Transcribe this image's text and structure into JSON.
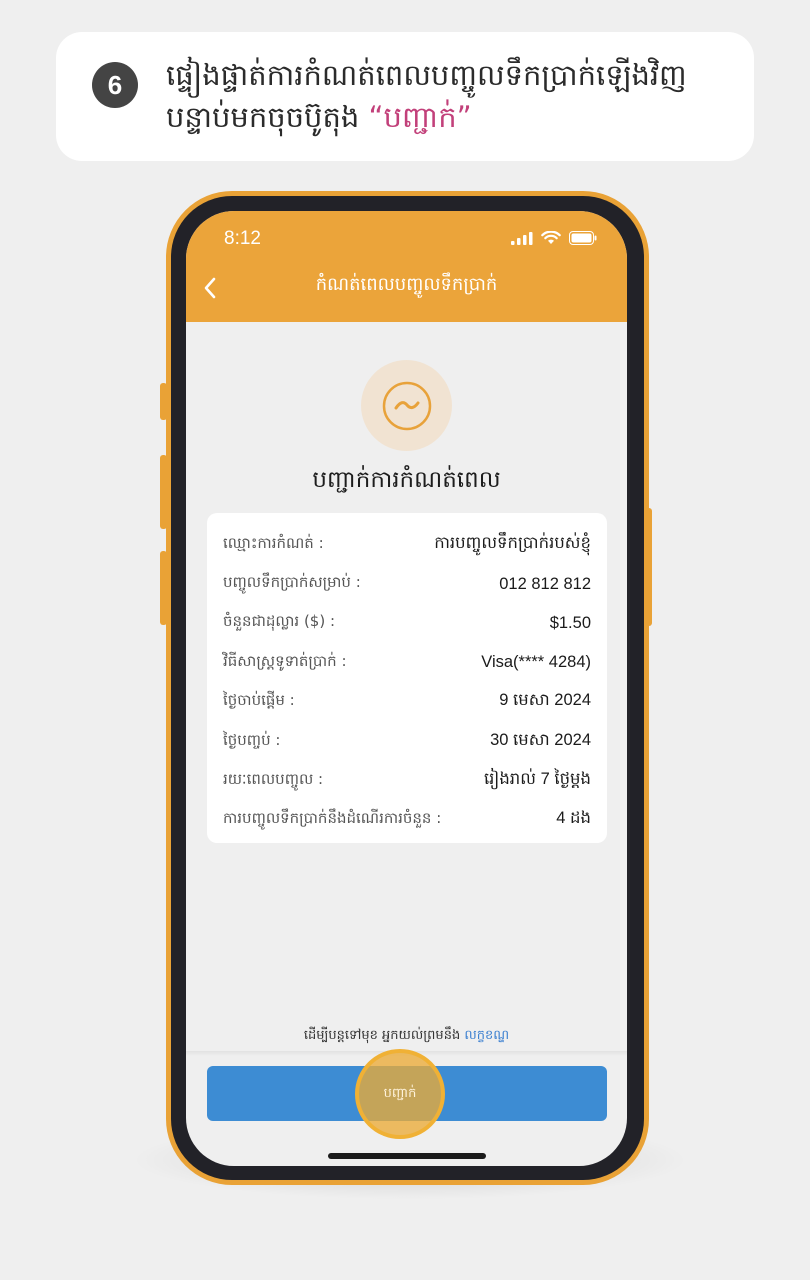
{
  "instruction": {
    "step_number": "6",
    "line1": "ផ្ទៀងផ្ទាត់ការកំណត់ពេលបញ្ចូលទឹកប្រាក់ឡើងវិញ",
    "line2_prefix": "បន្ទាប់មកចុចប៊ូតុង ",
    "line2_highlight": "“បញ្ជាក់”"
  },
  "status_bar": {
    "time": "8:12"
  },
  "header": {
    "title": "កំណត់ពេលបញ្ចូលទឹកប្រាក់"
  },
  "confirmation": {
    "title": "បញ្ជាក់ការកំណត់ពេល"
  },
  "details": [
    {
      "label": "ឈ្មោះការកំណត់ :",
      "value": "ការបញ្ចូលទឹកប្រាក់របស់ខ្ញុំ"
    },
    {
      "label": "បញ្ចូលទឹកប្រាក់សម្រាប់ :",
      "value": "012 812 812"
    },
    {
      "label": "ចំនួនជាដុល្លារ ($) :",
      "value": "$1.50"
    },
    {
      "label": "វិធីសាស្ត្រទូទាត់ប្រាក់ :",
      "value": "Visa(**** 4284)"
    },
    {
      "label": "ថ្ងៃចាប់ផ្ដើម :",
      "value": "9 មេសា 2024"
    },
    {
      "label": "ថ្ងៃបញ្ចប់ :",
      "value": "30 មេសា 2024"
    },
    {
      "label": "រយៈពេលបញ្ចូល :",
      "value": "រៀងរាល់ 7 ថ្ងៃម្ដង"
    },
    {
      "label": "ការបញ្ចូលទឹកប្រាក់នឹងដំណើរការចំនួន :",
      "value": "4 ដង"
    }
  ],
  "terms": {
    "text": "ដើម្បីបន្តទៅមុខ អ្នកយល់ព្រមនឹង ",
    "link": "លក្ខខណ្ឌ"
  },
  "confirm_button": {
    "label": "បញ្ជាក់"
  },
  "colors": {
    "header": "#eba43a",
    "button": "#3d8cd3",
    "frame": "#e9a236",
    "highlight": "#c2407a",
    "link": "#3a7fd0"
  }
}
